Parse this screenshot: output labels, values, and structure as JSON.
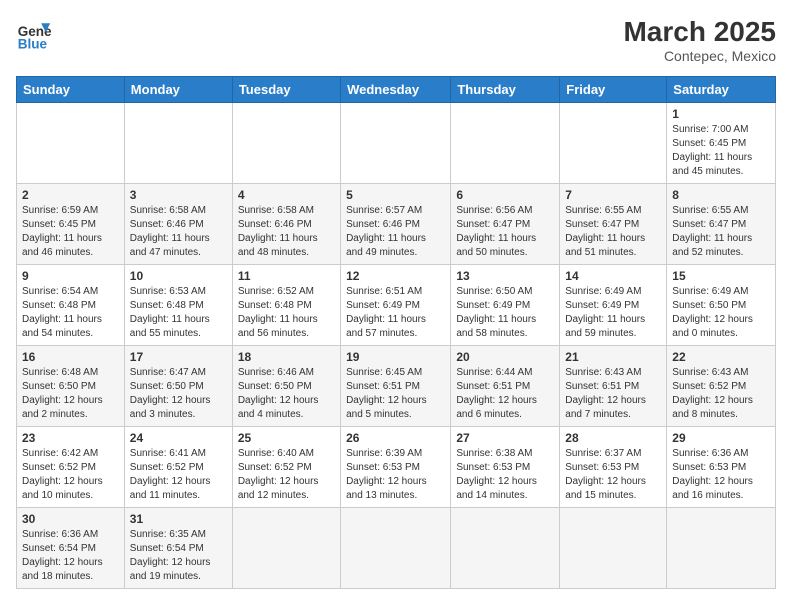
{
  "header": {
    "logo_general": "General",
    "logo_blue": "Blue",
    "month_year": "March 2025",
    "location": "Contepec, Mexico"
  },
  "days_of_week": [
    "Sunday",
    "Monday",
    "Tuesday",
    "Wednesday",
    "Thursday",
    "Friday",
    "Saturday"
  ],
  "weeks": [
    [
      {
        "day": "",
        "info": ""
      },
      {
        "day": "",
        "info": ""
      },
      {
        "day": "",
        "info": ""
      },
      {
        "day": "",
        "info": ""
      },
      {
        "day": "",
        "info": ""
      },
      {
        "day": "",
        "info": ""
      },
      {
        "day": "1",
        "info": "Sunrise: 7:00 AM\nSunset: 6:45 PM\nDaylight: 11 hours and 45 minutes."
      }
    ],
    [
      {
        "day": "2",
        "info": "Sunrise: 6:59 AM\nSunset: 6:45 PM\nDaylight: 11 hours and 46 minutes."
      },
      {
        "day": "3",
        "info": "Sunrise: 6:58 AM\nSunset: 6:46 PM\nDaylight: 11 hours and 47 minutes."
      },
      {
        "day": "4",
        "info": "Sunrise: 6:58 AM\nSunset: 6:46 PM\nDaylight: 11 hours and 48 minutes."
      },
      {
        "day": "5",
        "info": "Sunrise: 6:57 AM\nSunset: 6:46 PM\nDaylight: 11 hours and 49 minutes."
      },
      {
        "day": "6",
        "info": "Sunrise: 6:56 AM\nSunset: 6:47 PM\nDaylight: 11 hours and 50 minutes."
      },
      {
        "day": "7",
        "info": "Sunrise: 6:55 AM\nSunset: 6:47 PM\nDaylight: 11 hours and 51 minutes."
      },
      {
        "day": "8",
        "info": "Sunrise: 6:55 AM\nSunset: 6:47 PM\nDaylight: 11 hours and 52 minutes."
      }
    ],
    [
      {
        "day": "9",
        "info": "Sunrise: 6:54 AM\nSunset: 6:48 PM\nDaylight: 11 hours and 54 minutes."
      },
      {
        "day": "10",
        "info": "Sunrise: 6:53 AM\nSunset: 6:48 PM\nDaylight: 11 hours and 55 minutes."
      },
      {
        "day": "11",
        "info": "Sunrise: 6:52 AM\nSunset: 6:48 PM\nDaylight: 11 hours and 56 minutes."
      },
      {
        "day": "12",
        "info": "Sunrise: 6:51 AM\nSunset: 6:49 PM\nDaylight: 11 hours and 57 minutes."
      },
      {
        "day": "13",
        "info": "Sunrise: 6:50 AM\nSunset: 6:49 PM\nDaylight: 11 hours and 58 minutes."
      },
      {
        "day": "14",
        "info": "Sunrise: 6:49 AM\nSunset: 6:49 PM\nDaylight: 11 hours and 59 minutes."
      },
      {
        "day": "15",
        "info": "Sunrise: 6:49 AM\nSunset: 6:50 PM\nDaylight: 12 hours and 0 minutes."
      }
    ],
    [
      {
        "day": "16",
        "info": "Sunrise: 6:48 AM\nSunset: 6:50 PM\nDaylight: 12 hours and 2 minutes."
      },
      {
        "day": "17",
        "info": "Sunrise: 6:47 AM\nSunset: 6:50 PM\nDaylight: 12 hours and 3 minutes."
      },
      {
        "day": "18",
        "info": "Sunrise: 6:46 AM\nSunset: 6:50 PM\nDaylight: 12 hours and 4 minutes."
      },
      {
        "day": "19",
        "info": "Sunrise: 6:45 AM\nSunset: 6:51 PM\nDaylight: 12 hours and 5 minutes."
      },
      {
        "day": "20",
        "info": "Sunrise: 6:44 AM\nSunset: 6:51 PM\nDaylight: 12 hours and 6 minutes."
      },
      {
        "day": "21",
        "info": "Sunrise: 6:43 AM\nSunset: 6:51 PM\nDaylight: 12 hours and 7 minutes."
      },
      {
        "day": "22",
        "info": "Sunrise: 6:43 AM\nSunset: 6:52 PM\nDaylight: 12 hours and 8 minutes."
      }
    ],
    [
      {
        "day": "23",
        "info": "Sunrise: 6:42 AM\nSunset: 6:52 PM\nDaylight: 12 hours and 10 minutes."
      },
      {
        "day": "24",
        "info": "Sunrise: 6:41 AM\nSunset: 6:52 PM\nDaylight: 12 hours and 11 minutes."
      },
      {
        "day": "25",
        "info": "Sunrise: 6:40 AM\nSunset: 6:52 PM\nDaylight: 12 hours and 12 minutes."
      },
      {
        "day": "26",
        "info": "Sunrise: 6:39 AM\nSunset: 6:53 PM\nDaylight: 12 hours and 13 minutes."
      },
      {
        "day": "27",
        "info": "Sunrise: 6:38 AM\nSunset: 6:53 PM\nDaylight: 12 hours and 14 minutes."
      },
      {
        "day": "28",
        "info": "Sunrise: 6:37 AM\nSunset: 6:53 PM\nDaylight: 12 hours and 15 minutes."
      },
      {
        "day": "29",
        "info": "Sunrise: 6:36 AM\nSunset: 6:53 PM\nDaylight: 12 hours and 16 minutes."
      }
    ],
    [
      {
        "day": "30",
        "info": "Sunrise: 6:36 AM\nSunset: 6:54 PM\nDaylight: 12 hours and 18 minutes."
      },
      {
        "day": "31",
        "info": "Sunrise: 6:35 AM\nSunset: 6:54 PM\nDaylight: 12 hours and 19 minutes."
      },
      {
        "day": "",
        "info": ""
      },
      {
        "day": "",
        "info": ""
      },
      {
        "day": "",
        "info": ""
      },
      {
        "day": "",
        "info": ""
      },
      {
        "day": "",
        "info": ""
      }
    ]
  ]
}
